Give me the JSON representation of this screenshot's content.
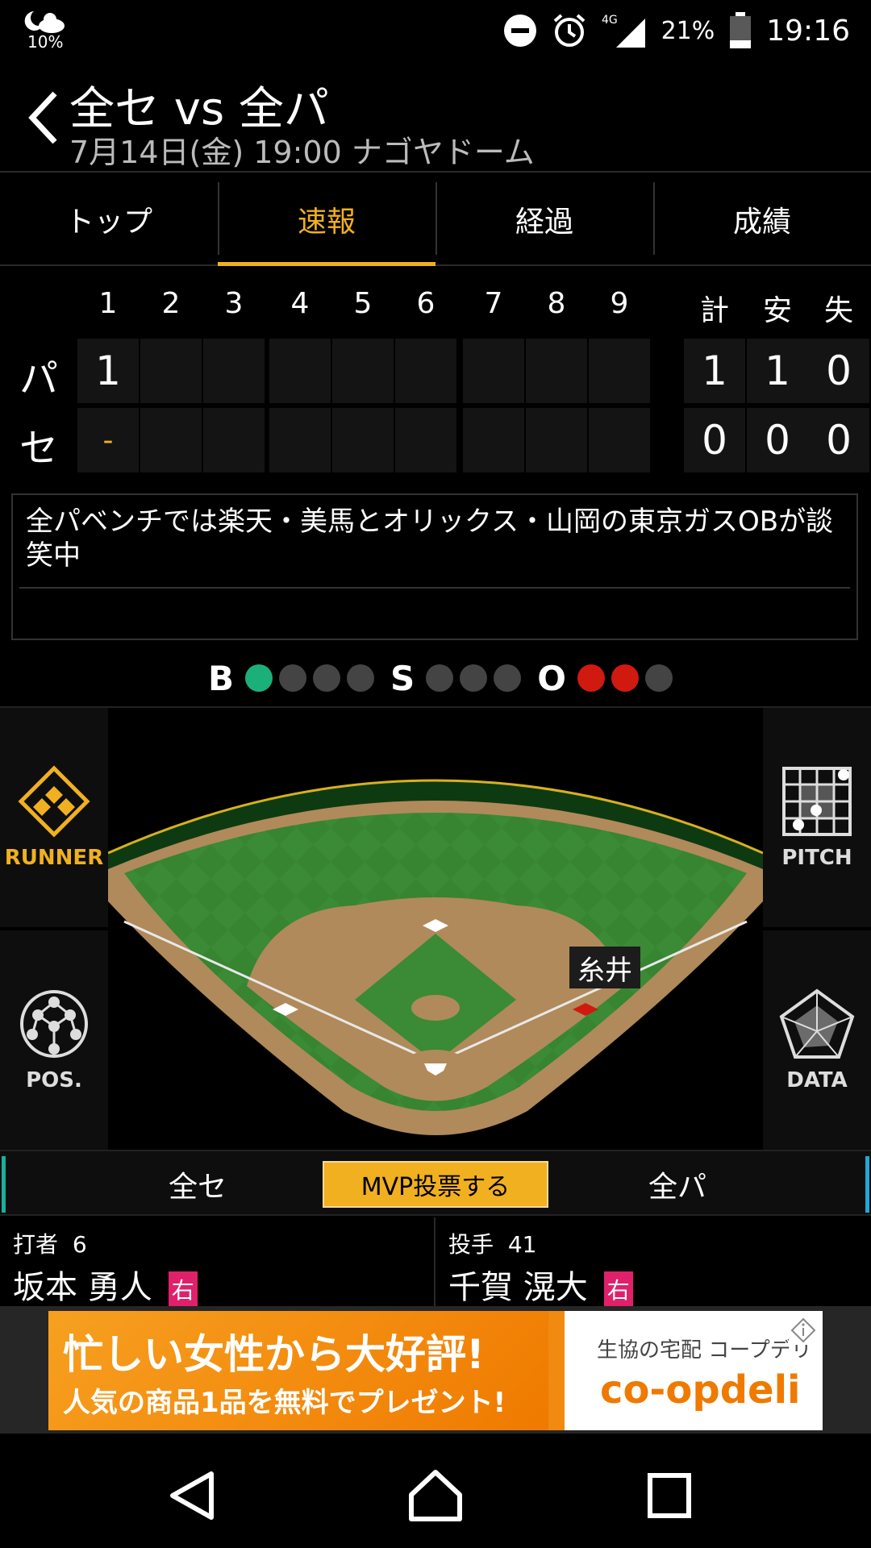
{
  "status_bar": {
    "weather_percent": "10%",
    "battery_percent": "21%",
    "time": "19:16",
    "network": "4G",
    "icons": [
      "weather-night-cloud-icon",
      "dnd-icon",
      "alarm-icon",
      "signal-icon",
      "battery-icon"
    ]
  },
  "header": {
    "title": "全セ vs 全パ",
    "subtitle": "7月14日(金) 19:00 ナゴヤドーム"
  },
  "tabs": [
    {
      "label": "トップ",
      "active": false
    },
    {
      "label": "速報",
      "active": true
    },
    {
      "label": "経過",
      "active": false
    },
    {
      "label": "成績",
      "active": false
    }
  ],
  "scoreboard": {
    "innings": [
      "1",
      "2",
      "3",
      "4",
      "5",
      "6",
      "7",
      "8",
      "9"
    ],
    "totals_headers": [
      "計",
      "安",
      "失"
    ],
    "teams": [
      {
        "name": "パ",
        "innings": [
          "1",
          "",
          "",
          "",
          "",
          "",
          "",
          "",
          ""
        ],
        "totals": [
          "1",
          "1",
          "0"
        ]
      },
      {
        "name": "セ",
        "innings": [
          "-",
          "",
          "",
          "",
          "",
          "",
          "",
          "",
          ""
        ],
        "totals": [
          "0",
          "0",
          "0"
        ]
      }
    ]
  },
  "commentary": {
    "text": "全パベンチでは楽天・美馬とオリックス・山岡の東京ガスOBが談笑中"
  },
  "count": {
    "ball_label": "B",
    "balls": 1,
    "ball_max": 4,
    "strike_label": "S",
    "strikes": 0,
    "strike_max": 3,
    "out_label": "O",
    "outs": 2,
    "out_max": 3,
    "colors": {
      "ball": "#1bb07a",
      "out": "#d01a10",
      "empty": "#444444"
    }
  },
  "field": {
    "runner_name": "糸井",
    "runner_base": "first"
  },
  "side_buttons": {
    "runner": "RUNNER",
    "pos": "POS.",
    "pitch": "PITCH",
    "data": "DATA"
  },
  "team_bar": {
    "left_team": "全セ",
    "right_team": "全パ",
    "mvp_button": "MVP投票する"
  },
  "players": {
    "batter": {
      "role": "打者",
      "number": "6",
      "name": "坂本 勇人",
      "hand": "右"
    },
    "pitcher": {
      "role": "投手",
      "number": "41",
      "name": "千賀 滉大",
      "hand": "右"
    }
  },
  "ad": {
    "line1": "忙しい女性から大好評!",
    "line2": "人気の商品1品を無料でプレゼント!",
    "brand_sub": "生協の宅配 コープデリ",
    "brand": "co-opdeli",
    "accent": "#ef7a00"
  },
  "navbar": {
    "icons": [
      "back-icon",
      "home-icon",
      "recents-icon"
    ]
  }
}
